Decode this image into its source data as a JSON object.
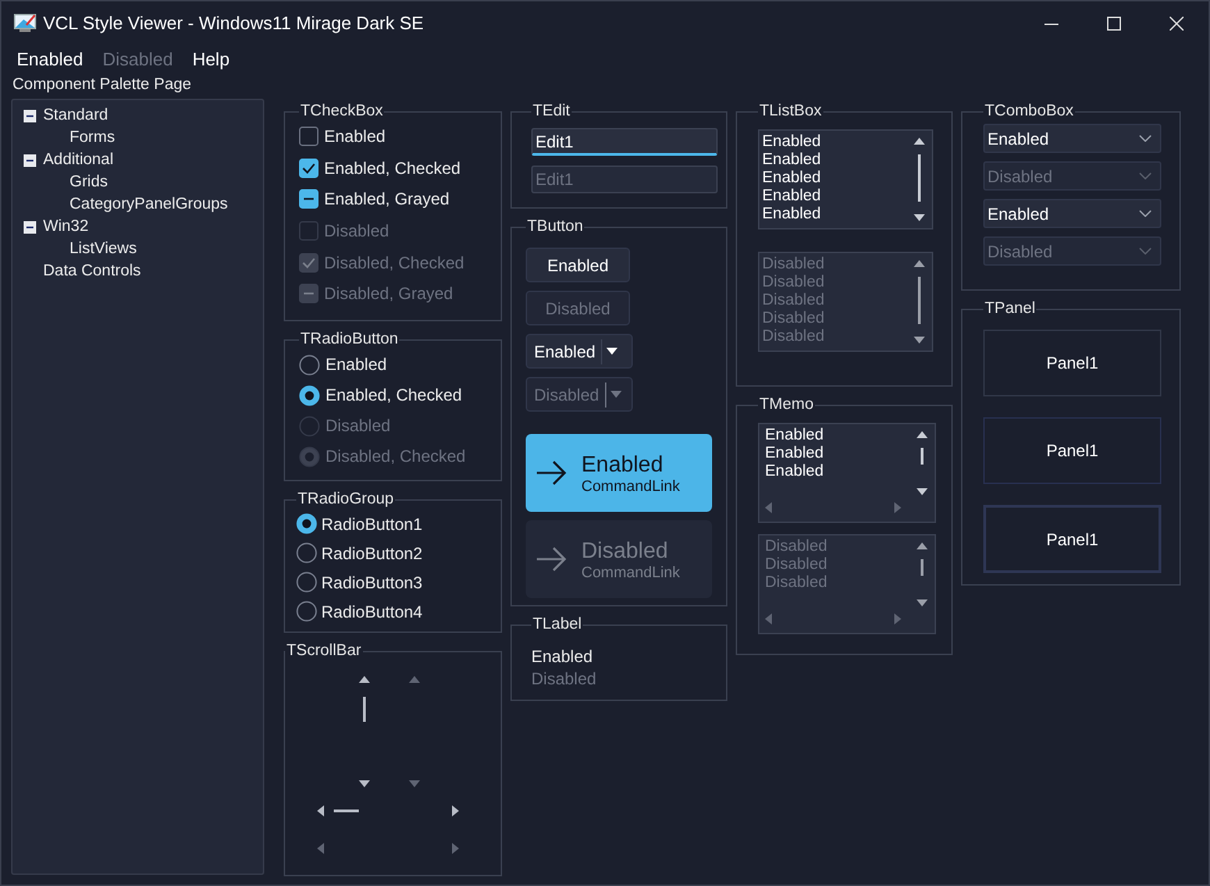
{
  "window": {
    "title": "VCL Style Viewer - Windows11 Mirage Dark SE"
  },
  "menu": [
    {
      "label": "Enabled",
      "disabled": false
    },
    {
      "label": "Disabled",
      "disabled": true
    },
    {
      "label": "Help",
      "disabled": false
    }
  ],
  "palette": {
    "label": "Component Palette Page",
    "tree": [
      {
        "label": "Standard",
        "expanded": true,
        "children": [
          {
            "label": "Forms"
          }
        ]
      },
      {
        "label": "Additional",
        "expanded": true,
        "children": [
          {
            "label": "Grids"
          },
          {
            "label": "CategoryPanelGroups"
          }
        ]
      },
      {
        "label": "Win32",
        "expanded": true,
        "children": [
          {
            "label": "ListViews"
          }
        ]
      },
      {
        "label": "Data Controls"
      }
    ]
  },
  "checkbox_group": {
    "title": "TCheckBox",
    "items": [
      {
        "label": "Enabled",
        "checked": false,
        "grayed": false,
        "disabled": false
      },
      {
        "label": "Enabled, Checked",
        "checked": true,
        "grayed": false,
        "disabled": false
      },
      {
        "label": "Enabled, Grayed",
        "checked": false,
        "grayed": true,
        "disabled": false
      },
      {
        "label": "Disabled",
        "checked": false,
        "grayed": false,
        "disabled": true
      },
      {
        "label": "Disabled, Checked",
        "checked": true,
        "grayed": false,
        "disabled": true
      },
      {
        "label": "Disabled, Grayed",
        "checked": false,
        "grayed": true,
        "disabled": true
      }
    ]
  },
  "radio_button_group": {
    "title": "TRadioButton",
    "items": [
      {
        "label": "Enabled",
        "checked": false,
        "disabled": false
      },
      {
        "label": "Enabled, Checked",
        "checked": true,
        "disabled": false
      },
      {
        "label": "Disabled",
        "checked": false,
        "disabled": true
      },
      {
        "label": "Disabled, Checked",
        "checked": true,
        "disabled": true
      }
    ]
  },
  "radio_group": {
    "title": "TRadioGroup",
    "items": [
      {
        "label": "RadioButton1",
        "selected": true
      },
      {
        "label": "RadioButton2",
        "selected": false
      },
      {
        "label": "RadioButton3",
        "selected": false
      },
      {
        "label": "RadioButton4",
        "selected": false
      }
    ]
  },
  "scrollbar_group": {
    "title": "TScrollBar",
    "scrollbars": [
      {
        "kind": "vertical",
        "disabled": false
      },
      {
        "kind": "vertical",
        "disabled": true
      },
      {
        "kind": "horizontal",
        "disabled": false
      },
      {
        "kind": "horizontal",
        "disabled": true
      }
    ]
  },
  "edit_group": {
    "title": "TEdit",
    "fields": [
      {
        "value": "Edit1",
        "disabled": false
      },
      {
        "value": "Edit1",
        "disabled": true
      }
    ]
  },
  "button_group": {
    "title": "TButton",
    "buttons": [
      {
        "kind": "push",
        "label": "Enabled",
        "disabled": false
      },
      {
        "kind": "push",
        "label": "Disabled",
        "disabled": true
      },
      {
        "kind": "split",
        "label": "Enabled",
        "disabled": false
      },
      {
        "kind": "split",
        "label": "Disabled",
        "disabled": true
      },
      {
        "kind": "command_link",
        "label": "Enabled",
        "note": "CommandLink",
        "disabled": false
      },
      {
        "kind": "command_link",
        "label": "Disabled",
        "note": "CommandLink",
        "disabled": true
      }
    ]
  },
  "label_group": {
    "title": "TLabel",
    "labels": [
      {
        "text": "Enabled",
        "disabled": false
      },
      {
        "text": "Disabled",
        "disabled": true
      }
    ]
  },
  "listbox_group": {
    "title": "TListBox",
    "listboxes": [
      {
        "disabled": false,
        "items": [
          "Enabled",
          "Enabled",
          "Enabled",
          "Enabled",
          "Enabled"
        ]
      },
      {
        "disabled": true,
        "items": [
          "Disabled",
          "Disabled",
          "Disabled",
          "Disabled",
          "Disabled"
        ]
      }
    ]
  },
  "memo_group": {
    "title": "TMemo",
    "memos": [
      {
        "disabled": false,
        "lines": [
          "Enabled",
          "Enabled",
          "Enabled"
        ]
      },
      {
        "disabled": true,
        "lines": [
          "Disabled",
          "Disabled",
          "Disabled"
        ]
      }
    ]
  },
  "combobox_group": {
    "title": "TComboBox",
    "comboboxes": [
      {
        "value": "Enabled",
        "disabled": false
      },
      {
        "value": "Disabled",
        "disabled": true
      },
      {
        "value": "Enabled",
        "disabled": false
      },
      {
        "value": "Disabled",
        "disabled": true
      }
    ]
  },
  "panel_group": {
    "title": "TPanel",
    "panels": [
      {
        "caption": "Panel1",
        "kind": "flat"
      },
      {
        "caption": "Panel1",
        "kind": "raised"
      },
      {
        "caption": "Panel1",
        "kind": "lowered"
      }
    ]
  }
}
